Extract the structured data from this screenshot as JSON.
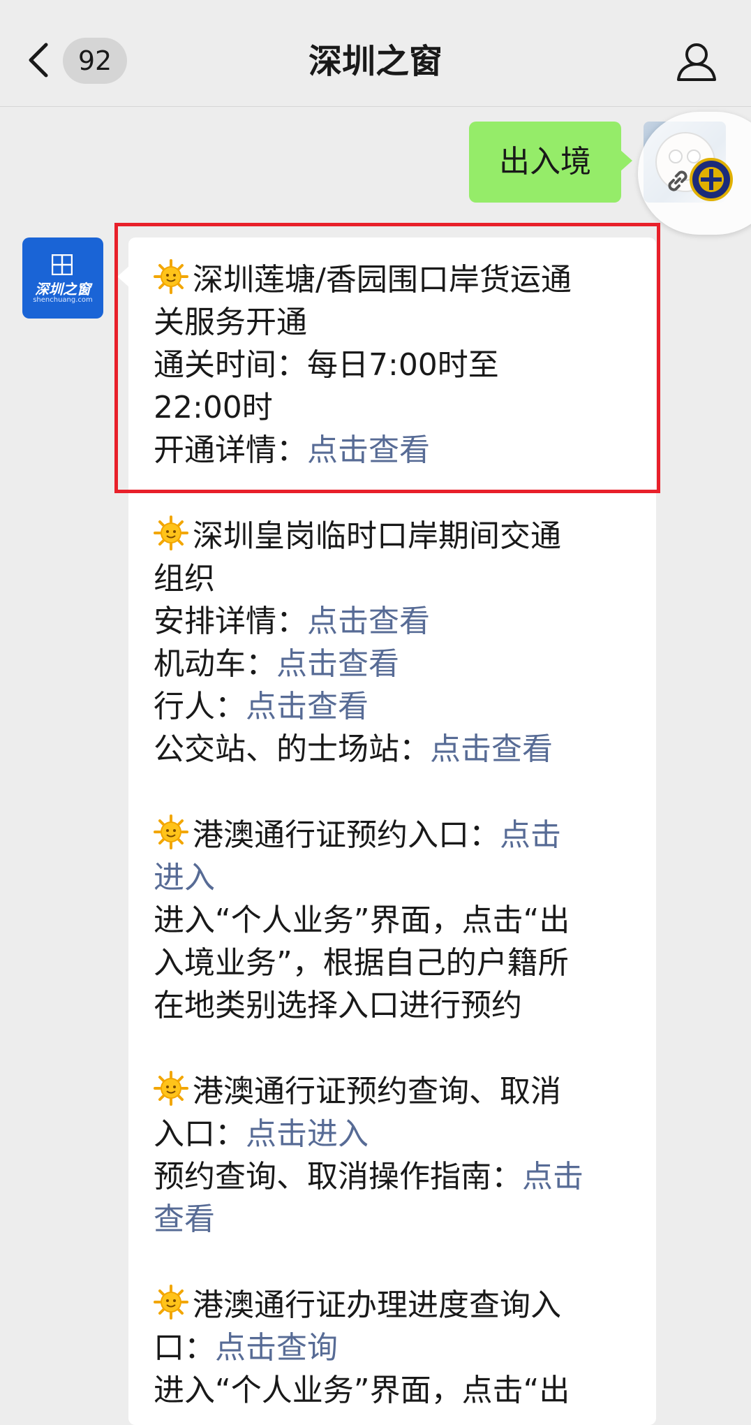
{
  "header": {
    "title": "深圳之窗",
    "unread_count": "92",
    "back_icon": "chevron-left-icon",
    "profile_icon": "person-icon"
  },
  "outgoing": {
    "text": "出入境"
  },
  "bot": {
    "logo_text": "深圳之窗",
    "logo_sub": "shenchuang.com"
  },
  "sections": [
    {
      "lines": [
        {
          "sun": true,
          "text": "深圳莲塘/香园围口岸货运通"
        },
        {
          "text": "关服务开通"
        },
        {
          "text": "通关时间：每日7:00时至"
        },
        {
          "text": "22:00时"
        },
        {
          "text": "开通详情：",
          "link": "点击查看"
        }
      ]
    },
    {
      "lines": [
        {
          "sun": true,
          "text": "深圳皇岗临时口岸期间交通"
        },
        {
          "text": "组织"
        },
        {
          "text": "安排详情：",
          "link": "点击查看"
        },
        {
          "text": "机动车：",
          "link": "点击查看"
        },
        {
          "text": "行人：",
          "link": "点击查看"
        },
        {
          "text": "公交站、的士场站：",
          "link": "点击查看"
        }
      ]
    },
    {
      "lines": [
        {
          "sun": true,
          "text": "港澳通行证预约入口：",
          "link": "点击"
        },
        {
          "text": "",
          "link": "进入"
        },
        {
          "text": "进入“个人业务”界面，点击“出"
        },
        {
          "text": "入境业务”，根据自己的户籍所"
        },
        {
          "text": "在地类别选择入口进行预约"
        }
      ]
    },
    {
      "lines": [
        {
          "sun": true,
          "text": "港澳通行证预约查询、取消"
        },
        {
          "text": "入口：",
          "link": "点击进入"
        },
        {
          "text": "预约查询、取消操作指南：",
          "link": "点击"
        },
        {
          "text": "",
          "link": "查看"
        }
      ]
    },
    {
      "lines": [
        {
          "sun": true,
          "text": "港澳通行证办理进度查询入"
        },
        {
          "text": "口：",
          "link": "点击查询"
        },
        {
          "text": "进入“个人业务”界面，点击“出"
        }
      ]
    }
  ],
  "colors": {
    "background": "#ededed",
    "outgoing_bubble": "#95ec69",
    "incoming_bubble": "#ffffff",
    "link": "#576b95",
    "highlight": "#e8202a",
    "bot_avatar": "#1a64d6"
  }
}
